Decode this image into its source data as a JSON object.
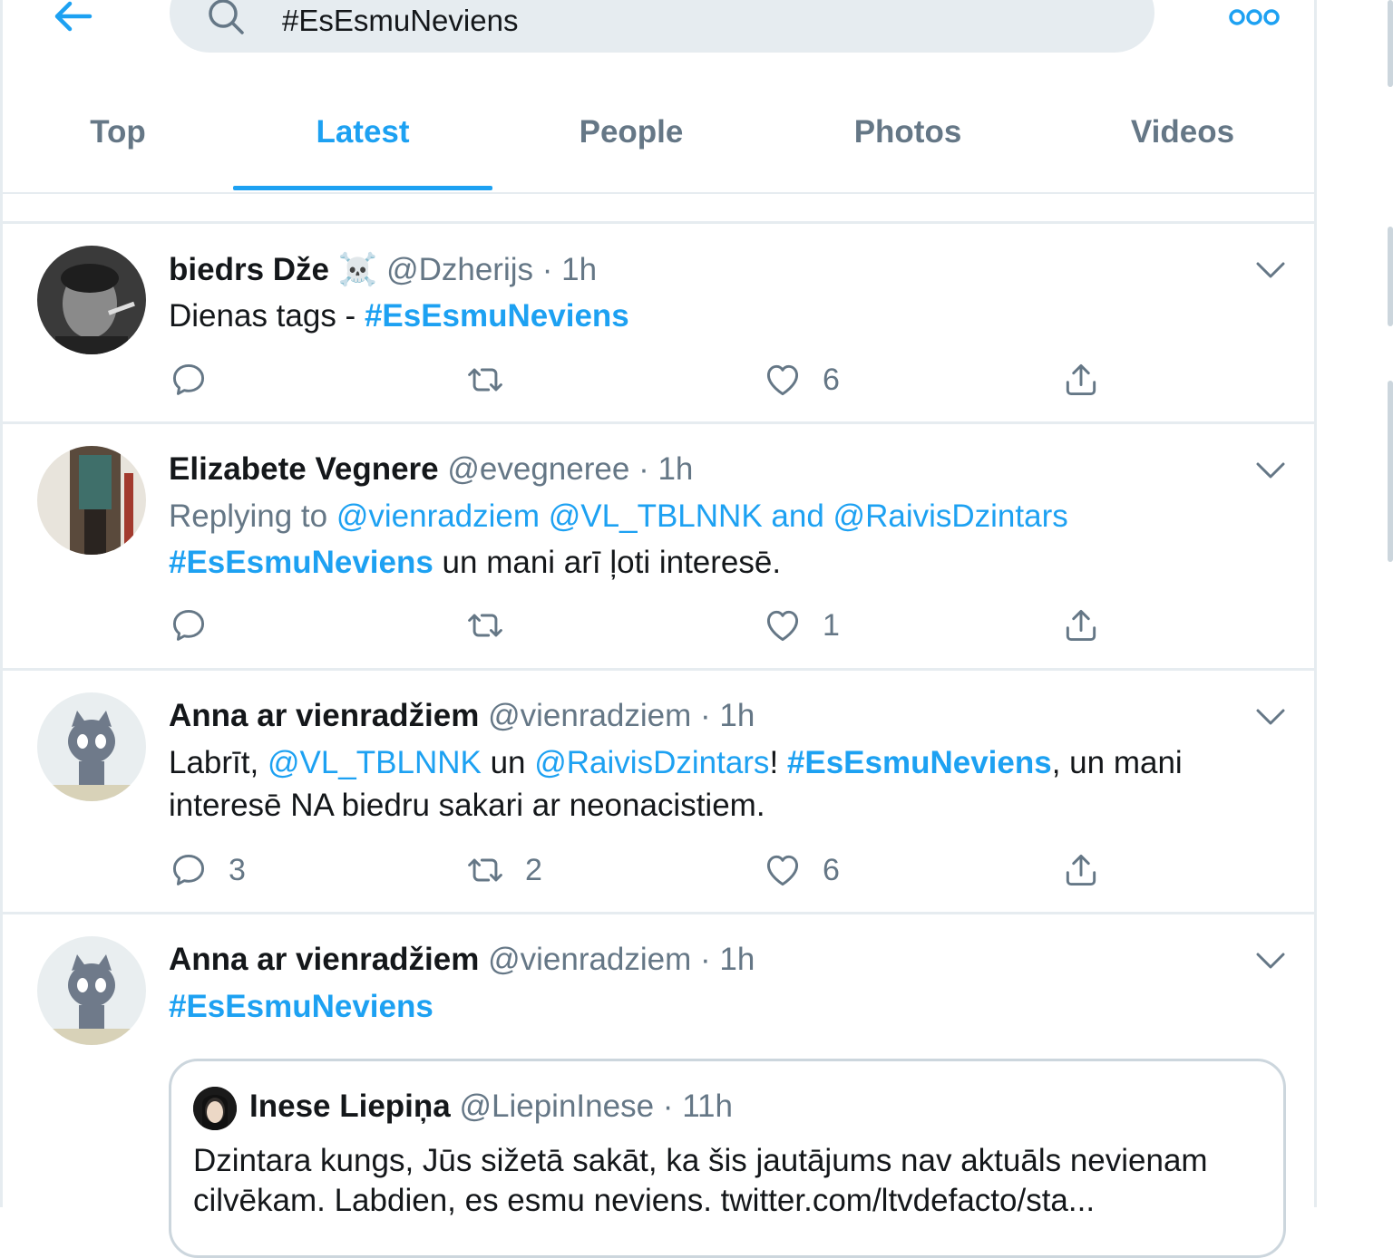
{
  "search": {
    "value": "#EsEsmuNeviens"
  },
  "tabs": [
    {
      "label": "Top"
    },
    {
      "label": "Latest"
    },
    {
      "label": "People"
    },
    {
      "label": "Photos"
    },
    {
      "label": "Videos"
    }
  ],
  "active_tab": "Latest",
  "colors": {
    "accent": "#1da1f2",
    "muted": "#657786",
    "border": "#e6ecf0"
  },
  "tweets": [
    {
      "name": "biedrs Dže",
      "badge": "☠️",
      "handle": "@Dzherijs",
      "time": "1h",
      "text_prefix": "Dienas tags - ",
      "hashtag": "#EsEsmuNeviens",
      "likes": "6"
    },
    {
      "name": "Elizabete Vegnere",
      "handle": "@evegneree",
      "time": "1h",
      "replying_label": "Replying to ",
      "replying_to_1": "@vienradziem",
      "replying_to_2": "@VL_TBLNNK",
      "replying_and": " and ",
      "replying_to_3": "@RaivisDzintars",
      "hashtag": "#EsEsmuNeviens",
      "text_suffix": " un mani arī ļoti interesē.",
      "likes": "1"
    },
    {
      "name": "Anna ar vienradžiem",
      "handle": "@vienradziem",
      "time": "1h",
      "text_a": "Labrīt, ",
      "mention_1": "@VL_TBLNNK",
      "text_b": " un ",
      "mention_2": "@RaivisDzintars",
      "text_c": "! ",
      "hashtag": "#EsEsmuNeviens",
      "text_d": ", un mani",
      "text_line2": "interesē NA biedru sakari ar neonacistiem.",
      "replies": "3",
      "retweets": "2",
      "likes": "6"
    },
    {
      "name": "Anna ar vienradžiem",
      "handle": "@vienradziem",
      "time": "1h",
      "hashtag": "#EsEsmuNeviens",
      "quote": {
        "name": "Inese Liepiņa",
        "handle": "@LiepinInese",
        "time": "11h",
        "line1": "Dzintara kungs, Jūs sižetā sakāt, ka šis jautājums nav aktuāls nevienam",
        "line2": "cilvēkam. Labdien, es esmu neviens. twitter.com/ltvdefacto/sta..."
      }
    }
  ],
  "dot": "·"
}
